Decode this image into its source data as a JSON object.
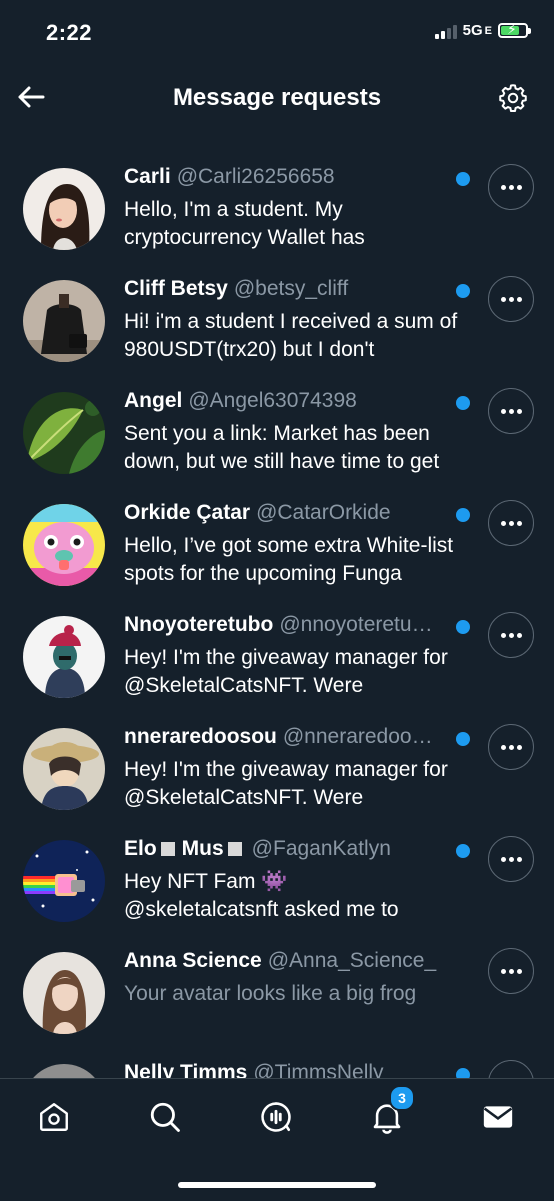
{
  "status_bar": {
    "time": "2:22",
    "network": "5G",
    "network_suffix": "E"
  },
  "header": {
    "title": "Message requests"
  },
  "requests": [
    {
      "name": "Carli",
      "handle": "@Carli26256658",
      "preview": "Hello, I'm a student. My cryptocurrency Wallet has",
      "unread": true
    },
    {
      "name": "Cliff Betsy",
      "handle": "@betsy_cliff",
      "preview": "Hi!  i'm a student  I received a sum of 980USDT(trx20) but I don't",
      "unread": true
    },
    {
      "name": "Angel",
      "handle": "@Angel63074398",
      "preview": "Sent you a link: Market has been down, but we still have time to get",
      "unread": true
    },
    {
      "name": "Orkide Çatar",
      "handle": "@CatarOrkide",
      "preview": "Hello, I’ve got some extra White-list spots for the upcoming Funga",
      "unread": true
    },
    {
      "name": "Nnoyoteretubo",
      "handle": "@nnoyoteretu…",
      "preview": "Hey! I'm the giveaway manager for @SkeletalCatsNFT. Were",
      "unread": true
    },
    {
      "name": "nneraredoosou",
      "handle": "@nneraredoo…",
      "preview": "Hey! I'm the giveaway manager for @SkeletalCatsNFT. Were",
      "unread": true
    },
    {
      "name_part1": "Elo",
      "name_part2": "Mus",
      "handle": "@FaganKatlyn",
      "preview_line1": "Hey NFT Fam 👾",
      "preview_line2": "@skeletalcatsnft asked me to",
      "unread": true
    },
    {
      "name": "Anna Science",
      "handle": "@Anna_Science_",
      "preview": "Your avatar looks like a big frog",
      "unread": false
    },
    {
      "name": "Nelly Timms",
      "handle": "@TimmsNelly",
      "unread": true
    }
  ],
  "tabbar": {
    "notifications_badge": "3"
  },
  "icons": {
    "back": "arrow-left-icon",
    "settings": "gear-icon",
    "more": "more-horizontal-icon",
    "home": "home-icon",
    "search": "search-icon",
    "spaces": "spaces-icon",
    "notifications": "bell-icon",
    "messages": "envelope-icon"
  },
  "colors": {
    "background": "#15202b",
    "accent": "#1d9bf0",
    "muted_text": "#8b98a5",
    "divider": "#38444d"
  }
}
